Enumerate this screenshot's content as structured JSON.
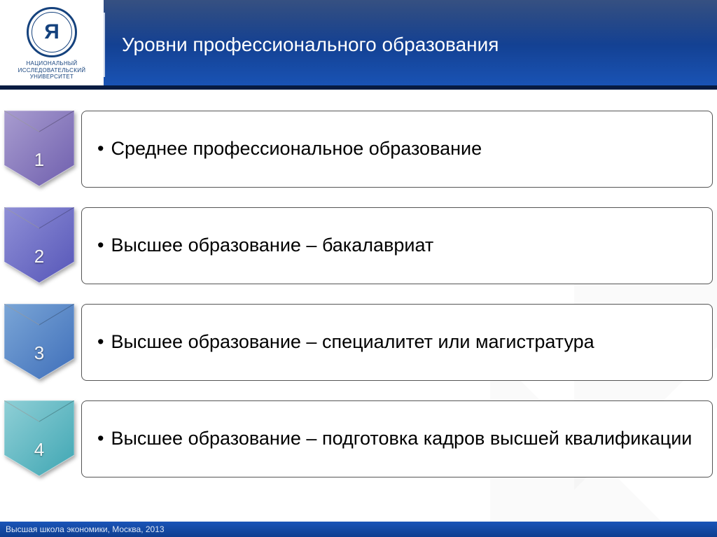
{
  "header": {
    "title": "Уровни профессионального образования",
    "logo_line1": "НАЦИОНАЛЬНЫЙ ИССЛЕДОВАТЕЛЬСКИЙ",
    "logo_line2": "УНИВЕРСИТЕТ"
  },
  "levels": [
    {
      "num": "1",
      "text": "Среднее профессиональное образование",
      "fillTop": "#a89ccf",
      "fillBot": "#6f5fae"
    },
    {
      "num": "2",
      "text": "Высшее образование – бакалавриат",
      "fillTop": "#8f8fd6",
      "fillBot": "#5656b8"
    },
    {
      "num": "3",
      "text": "Высшее образование – специалитет или магистратура",
      "fillTop": "#7aa5d6",
      "fillBot": "#3f6fba"
    },
    {
      "num": "4",
      "text": "Высшее образование – подготовка кадров высшей квалификации",
      "fillTop": "#8fcfd6",
      "fillBot": "#3fa6b3"
    }
  ],
  "footer": "Высшая школа экономики, Москва, 2013"
}
